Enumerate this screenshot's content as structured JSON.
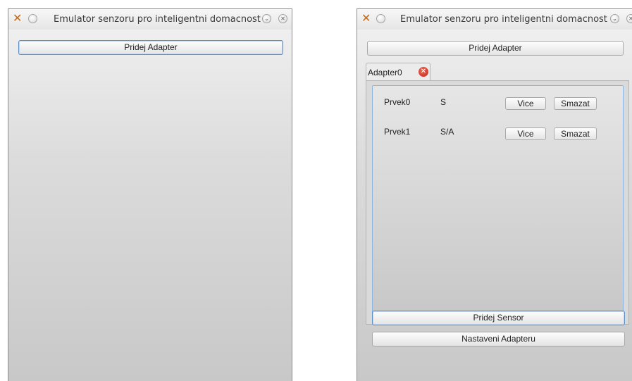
{
  "left_window": {
    "title": "Emulator senzoru pro inteligentni domacnost",
    "add_adapter_label": "Pridej Adapter"
  },
  "right_window": {
    "title": "Emulator senzoru pro inteligentni domacnost",
    "add_adapter_label": "Pridej Adapter",
    "tabs": [
      {
        "label": "Adapter0"
      }
    ],
    "sensors": [
      {
        "name": "Prvek0",
        "type": "S",
        "more_label": "Vice",
        "delete_label": "Smazat"
      },
      {
        "name": "Prvek1",
        "type": "S/A",
        "more_label": "Vice",
        "delete_label": "Smazat"
      }
    ],
    "add_sensor_label": "Pridej Sensor",
    "adapter_settings_label": "Nastaveni Adapteru"
  }
}
